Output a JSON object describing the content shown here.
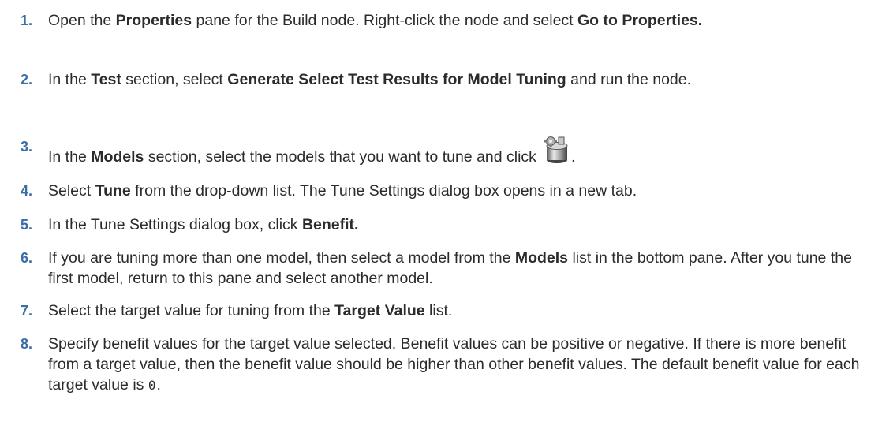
{
  "steps": [
    {
      "number": "1.",
      "parts": [
        {
          "t": "Open the ",
          "bold": false
        },
        {
          "t": "Properties",
          "bold": true
        },
        {
          "t": " pane for the Build node. Right-click the node and select ",
          "bold": false
        },
        {
          "t": "Go to Properties.",
          "bold": true
        }
      ]
    },
    {
      "number": "2.",
      "parts": [
        {
          "t": "In the ",
          "bold": false
        },
        {
          "t": "Test",
          "bold": true
        },
        {
          "t": " section, select ",
          "bold": false
        },
        {
          "t": "Generate Select Test Results for Model Tuning",
          "bold": true
        },
        {
          "t": " and run the node.",
          "bold": false
        }
      ]
    },
    {
      "number": "3.",
      "parts": [
        {
          "t": "In the ",
          "bold": false
        },
        {
          "t": "Models",
          "bold": true
        },
        {
          "t": " section, select the models that you want to tune and click",
          "bold": false
        }
      ],
      "icon": "action-gear-icon",
      "after_icon": "."
    },
    {
      "number": "4.",
      "parts": [
        {
          "t": "Select ",
          "bold": false
        },
        {
          "t": "Tune",
          "bold": true
        },
        {
          "t": " from the drop-down list. The Tune Settings dialog box opens in a new tab.",
          "bold": false
        }
      ]
    },
    {
      "number": "5.",
      "parts": [
        {
          "t": "In the Tune Settings dialog box, click ",
          "bold": false
        },
        {
          "t": "Benefit.",
          "bold": true
        }
      ]
    },
    {
      "number": "6.",
      "parts": [
        {
          "t": "If you are tuning more than one model, then select a model from the ",
          "bold": false
        },
        {
          "t": "Models",
          "bold": true
        },
        {
          "t": " list in the bottom pane. After you tune the first model, return to this pane and select another model.",
          "bold": false
        }
      ]
    },
    {
      "number": "7.",
      "parts": [
        {
          "t": "Select the target value for tuning from the ",
          "bold": false
        },
        {
          "t": "Target Value",
          "bold": true
        },
        {
          "t": " list.",
          "bold": false
        }
      ]
    },
    {
      "number": "8.",
      "parts": [
        {
          "t": "Specify benefit values for the target value selected. Benefit values can be positive or negative. If there is more benefit from a target value, then the benefit value should be higher than other benefit values. The default benefit value for each target value is ",
          "bold": false
        },
        {
          "t": "0",
          "bold": false,
          "code": true
        },
        {
          "t": ".",
          "bold": false
        }
      ]
    }
  ],
  "colors": {
    "text": "#2b2b2b",
    "number": "#3a6ea5"
  }
}
